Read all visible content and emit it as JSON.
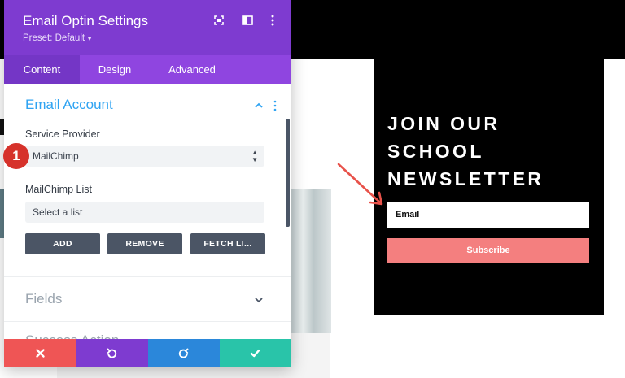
{
  "panel": {
    "title": "Email Optin Settings",
    "preset": "Preset: Default",
    "tabs": [
      {
        "label": "Content",
        "active": true
      },
      {
        "label": "Design",
        "active": false
      },
      {
        "label": "Advanced",
        "active": false
      }
    ],
    "sections": {
      "email_account": {
        "title": "Email Account",
        "service_provider_label": "Service Provider",
        "service_provider_value": "MailChimp",
        "list_label": "MailChimp List",
        "list_value": "Select a list",
        "buttons": [
          "ADD",
          "REMOVE",
          "FETCH LI..."
        ]
      },
      "fields": {
        "title": "Fields"
      },
      "partial_next": {
        "title": "Success Action"
      }
    },
    "footer": {
      "colors": {
        "cancel": "#ef5555",
        "undo": "#7e3bd0",
        "redo": "#2b87da",
        "save": "#29c4a9"
      }
    }
  },
  "step_badge": "1",
  "newsletter": {
    "title": "JOIN OUR\nSCHOOL\nNEWSLETTER",
    "email_placeholder": "Email",
    "subscribe_label": "Subscribe"
  },
  "colors": {
    "panel_header": "#7e3bd0",
    "tabs_bar": "#8f45e0",
    "accent_blue": "#2ea3f2",
    "subscribe": "#f47f7f",
    "badge": "#d6322b"
  }
}
